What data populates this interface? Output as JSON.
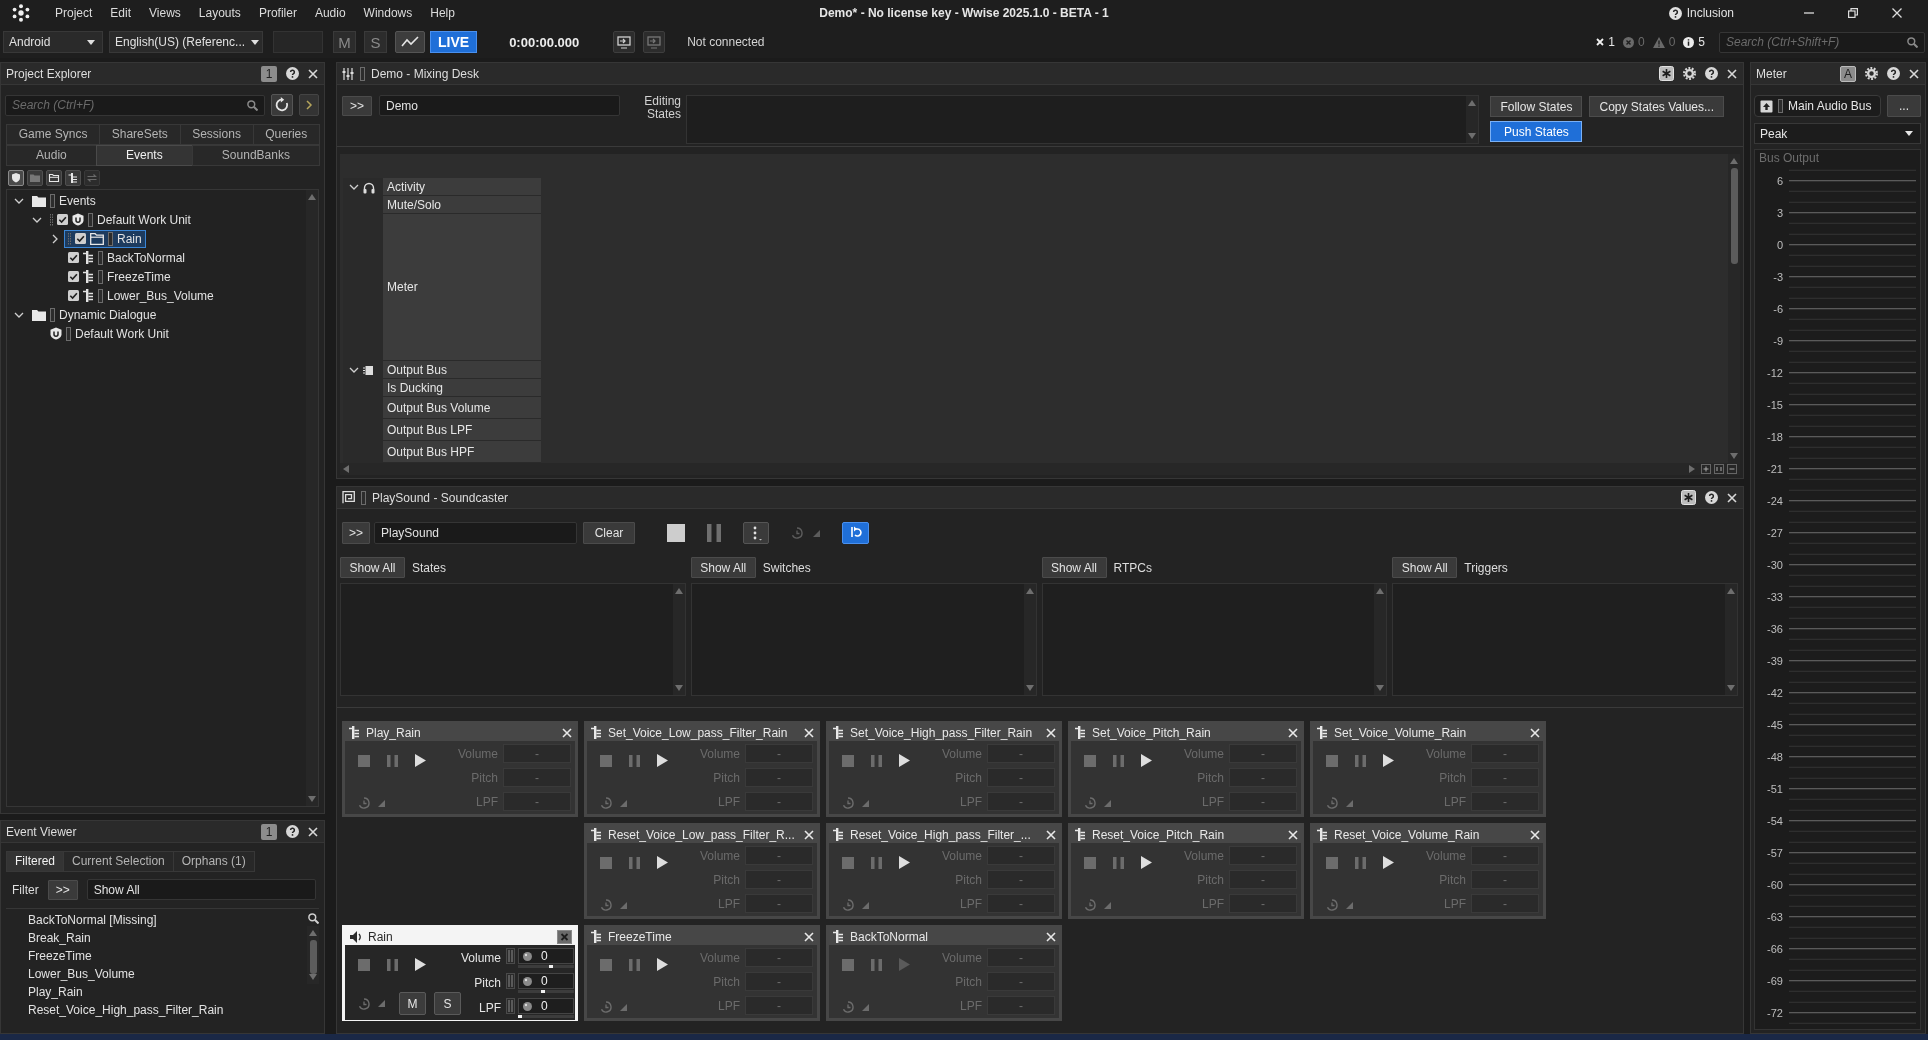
{
  "menu_bar": {
    "items": [
      "Project",
      "Edit",
      "Views",
      "Layouts",
      "Profiler",
      "Audio",
      "Windows",
      "Help"
    ],
    "title": "Demo* - No license key - Wwise 2025.1.0 - BETA - 1",
    "user": "Inclusion"
  },
  "toolbar": {
    "platform": "Android",
    "language": "English(US) (Referenc...",
    "mute": "M",
    "solo": "S",
    "live": "LIVE",
    "time": "0:00:00.000",
    "connection": "Not connected",
    "counts": [
      {
        "kind": "dismiss",
        "value": "1"
      },
      {
        "kind": "error",
        "value": "0"
      },
      {
        "kind": "warning",
        "value": "0"
      },
      {
        "kind": "info",
        "value": "5"
      }
    ],
    "search": {
      "placeholder": "Search (Ctrl+Shift+F)"
    }
  },
  "project_explorer": {
    "title": "Project Explorer",
    "badge": "1",
    "search": {
      "placeholder": "Search (Ctrl+F)"
    },
    "tab_rows": [
      [
        {
          "label": "Game Syncs",
          "selected": false
        },
        {
          "label": "ShareSets",
          "selected": false
        },
        {
          "label": "Sessions",
          "selected": false
        },
        {
          "label": "Queries",
          "selected": false
        }
      ],
      [
        {
          "label": "Audio",
          "selected": false
        },
        {
          "label": "Events",
          "selected": true
        },
        {
          "label": "SoundBanks",
          "selected": false
        }
      ]
    ],
    "tree": [
      {
        "label": "Events",
        "kind": "folder",
        "expanded": true,
        "selected": false,
        "children": [
          {
            "label": "Default Work Unit",
            "kind": "work_unit",
            "checked": true,
            "expanded": true,
            "selected": false,
            "children": [
              {
                "label": "Rain",
                "kind": "virtual_folder",
                "checked": true,
                "expanded": false,
                "selected": true
              },
              {
                "label": "BackToNormal",
                "kind": "event",
                "checked": true,
                "selected": false
              },
              {
                "label": "FreezeTime",
                "kind": "event",
                "checked": true,
                "selected": false
              },
              {
                "label": "Lower_Bus_Volume",
                "kind": "event",
                "checked": true,
                "selected": false
              }
            ]
          }
        ]
      },
      {
        "label": "Dynamic Dialogue",
        "kind": "folder",
        "expanded": true,
        "selected": false,
        "children": [
          {
            "label": "Default Work Unit",
            "kind": "work_unit",
            "selected": false
          }
        ]
      }
    ]
  },
  "event_viewer": {
    "title": "Event Viewer",
    "badge": "1",
    "tabs": [
      {
        "label": "Filtered",
        "selected": true
      },
      {
        "label": "Current Selection",
        "selected": false
      },
      {
        "label": "Orphans (1)",
        "selected": false
      }
    ],
    "filter_label": "Filter",
    "filter_button": ">>",
    "filter_value": "Show All",
    "items": [
      "BackToNormal [Missing]",
      "Break_Rain",
      "FreezeTime",
      "Lower_Bus_Volume",
      "Play_Rain",
      "Reset_Voice_High_pass_Filter_Rain"
    ]
  },
  "mixing_desk": {
    "title": "Demo - Mixing Desk",
    "expand_button": ">>",
    "name": "Demo",
    "states_label": "Editing States",
    "buttons": [
      {
        "label": "Follow States",
        "on": false
      },
      {
        "label": "Copy States Values...",
        "on": false
      },
      {
        "label": "Push States",
        "on": true
      }
    ],
    "row_groups": [
      {
        "kind": "activity",
        "expanded": true,
        "rows": [
          {
            "label": "Activity",
            "kind": "row"
          },
          {
            "label": "Mute/Solo",
            "kind": "row"
          },
          {
            "label": "Meter",
            "kind": "meter"
          }
        ]
      },
      {
        "kind": "bus",
        "expanded": true,
        "rows": [
          {
            "label": "Output Bus",
            "kind": "row"
          },
          {
            "label": "Is Ducking",
            "kind": "row"
          },
          {
            "label": "Output Bus Volume",
            "kind": "slider"
          },
          {
            "label": "Output Bus LPF",
            "kind": "slider"
          },
          {
            "label": "Output Bus HPF",
            "kind": "slider"
          }
        ]
      }
    ]
  },
  "soundcaster": {
    "title": "PlaySound - Soundcaster",
    "expand_button": ">>",
    "name": "PlaySound",
    "clear_button": "Clear",
    "panes": [
      {
        "button": "Show All",
        "label": "States"
      },
      {
        "button": "Show All",
        "label": "Switches"
      },
      {
        "button": "Show All",
        "label": "RTPCs"
      },
      {
        "button": "Show All",
        "label": "Triggers"
      }
    ],
    "card_rows": [
      {
        "cards": [
          {
            "kind": "event",
            "title": "Play_Rain",
            "selected": false,
            "playable": true,
            "params": [
              {
                "label": "Volume",
                "value": "-"
              },
              {
                "label": "Pitch",
                "value": "-"
              },
              {
                "label": "LPF",
                "value": "-"
              }
            ]
          },
          {
            "kind": "event",
            "title": "Set_Voice_Low_pass_Filter_Rain",
            "selected": false,
            "playable": true,
            "params": [
              {
                "label": "Volume",
                "value": "-"
              },
              {
                "label": "Pitch",
                "value": "-"
              },
              {
                "label": "LPF",
                "value": "-"
              }
            ]
          },
          {
            "kind": "event",
            "title": "Set_Voice_High_pass_Filter_Rain",
            "selected": false,
            "playable": true,
            "params": [
              {
                "label": "Volume",
                "value": "-"
              },
              {
                "label": "Pitch",
                "value": "-"
              },
              {
                "label": "LPF",
                "value": "-"
              }
            ]
          },
          {
            "kind": "event",
            "title": "Set_Voice_Pitch_Rain",
            "selected": false,
            "playable": true,
            "params": [
              {
                "label": "Volume",
                "value": "-"
              },
              {
                "label": "Pitch",
                "value": "-"
              },
              {
                "label": "LPF",
                "value": "-"
              }
            ]
          },
          {
            "kind": "event",
            "title": "Set_Voice_Volume_Rain",
            "selected": false,
            "playable": true,
            "params": [
              {
                "label": "Volume",
                "value": "-"
              },
              {
                "label": "Pitch",
                "value": "-"
              },
              {
                "label": "LPF",
                "value": "-"
              }
            ]
          }
        ]
      },
      {
        "cards": [
          {
            "kind": "empty"
          },
          {
            "kind": "event",
            "title": "Reset_Voice_Low_pass_Filter_R...",
            "selected": false,
            "playable": true,
            "params": [
              {
                "label": "Volume",
                "value": "-"
              },
              {
                "label": "Pitch",
                "value": "-"
              },
              {
                "label": "LPF",
                "value": "-"
              }
            ]
          },
          {
            "kind": "event",
            "title": "Reset_Voice_High_pass_Filter_...",
            "selected": false,
            "playable": true,
            "params": [
              {
                "label": "Volume",
                "value": "-"
              },
              {
                "label": "Pitch",
                "value": "-"
              },
              {
                "label": "LPF",
                "value": "-"
              }
            ]
          },
          {
            "kind": "event",
            "title": "Reset_Voice_Pitch_Rain",
            "selected": false,
            "playable": true,
            "params": [
              {
                "label": "Volume",
                "value": "-"
              },
              {
                "label": "Pitch",
                "value": "-"
              },
              {
                "label": "LPF",
                "value": "-"
              }
            ]
          },
          {
            "kind": "event",
            "title": "Reset_Voice_Volume_Rain",
            "selected": false,
            "playable": true,
            "params": [
              {
                "label": "Volume",
                "value": "-"
              },
              {
                "label": "Pitch",
                "value": "-"
              },
              {
                "label": "LPF",
                "value": "-"
              }
            ]
          }
        ]
      },
      {
        "cards": [
          {
            "kind": "object",
            "title": "Rain",
            "selected": true,
            "playable": true,
            "params": [
              {
                "label": "Volume",
                "value": "0",
                "level": 0.6
              },
              {
                "label": "Pitch",
                "value": "0",
                "level": 0.45
              },
              {
                "label": "LPF",
                "value": "0",
                "level": 0
              }
            ],
            "buttons": [
              "M",
              "S"
            ]
          },
          {
            "kind": "event",
            "title": "FreezeTime",
            "selected": false,
            "playable": true,
            "params": [
              {
                "label": "Volume",
                "value": "-"
              },
              {
                "label": "Pitch",
                "value": "-"
              },
              {
                "label": "LPF",
                "value": "-"
              }
            ]
          },
          {
            "kind": "event",
            "title": "BackToNormal",
            "selected": false,
            "playable": false,
            "params": [
              {
                "label": "Volume",
                "value": "-"
              },
              {
                "label": "Pitch",
                "value": "-"
              },
              {
                "label": "LPF",
                "value": "-"
              }
            ]
          }
        ]
      }
    ]
  },
  "meter": {
    "title": "Meter",
    "badge": "A",
    "bus": "Main Audio Bus",
    "more_button": "...",
    "mode": "Peak",
    "label": "Bus Output",
    "scale": [
      "6",
      "3",
      "0",
      "-3",
      "-6",
      "-9",
      "-12",
      "-15",
      "-18",
      "-21",
      "-24",
      "-27",
      "-30",
      "-33",
      "-36",
      "-39",
      "-42",
      "-45",
      "-48",
      "-51",
      "-54",
      "-57",
      "-60",
      "-63",
      "-66",
      "-69",
      "-72"
    ]
  }
}
